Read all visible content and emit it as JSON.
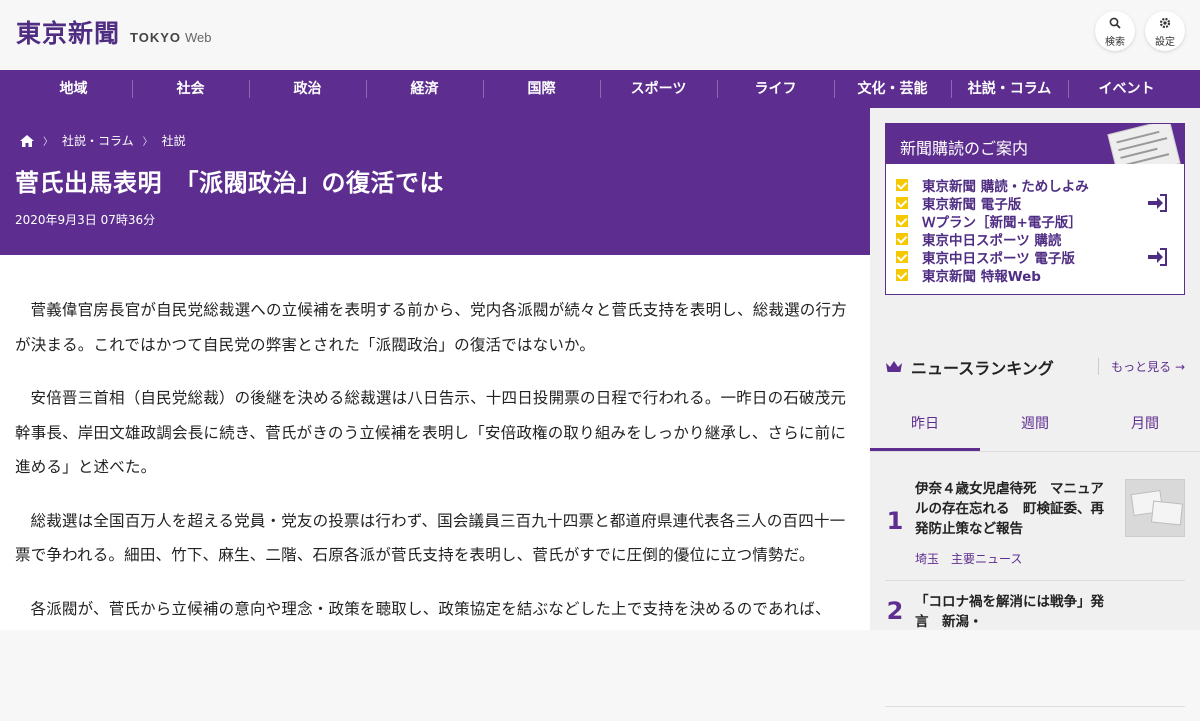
{
  "header": {
    "logo_kanji": "東京新聞",
    "logo_tokyo": "TOKYO",
    "logo_web": "Web",
    "search_label": "検索",
    "settings_label": "設定"
  },
  "nav": {
    "items": [
      "地域",
      "社会",
      "政治",
      "経済",
      "国際",
      "スポーツ",
      "ライフ",
      "文化・芸能",
      "社説・コラム",
      "イベント"
    ]
  },
  "breadcrumb": {
    "items": [
      "社説・コラム",
      "社説"
    ]
  },
  "article": {
    "title": "菅氏出馬表明　「派閥政治」の復活では",
    "date": "2020年9月3日 07時36分",
    "paragraphs": [
      "菅義偉官房長官が自民党総裁選への立候補を表明する前から、党内各派閥が続々と菅氏支持を表明し、総裁選の行方が決まる。これではかつて自民党の弊害とされた「派閥政治」の復活ではないか。",
      "安倍晋三首相（自民党総裁）の後継を決める総裁選は八日告示、十四日投開票の日程で行われる。一昨日の石破茂元幹事長、岸田文雄政調会長に続き、菅氏がきのう立候補を表明し「安倍政権の取り組みをしっかり継承し、さらに前に進める」と述べた。",
      "総裁選は全国百万人を超える党員・党友の投票は行わず、国会議員三百九十四票と都道府県連代表各三人の百四十一票で争われる。細田、竹下、麻生、二階、石原各派が菅氏支持を表明し、菅氏がすでに圧倒的優位に立つ情勢だ。",
      "各派閥が、菅氏から立候補の意向や理念・政策を聴取し、政策協定を結ぶなどした上で支持を決めるのであれば、"
    ]
  },
  "subscription": {
    "heading": "新聞購読のご案内",
    "items": [
      "東京新聞 購読・ためしよみ",
      "東京新聞 電子版",
      "Ｗプラン［新聞+電子版］",
      "東京中日スポーツ 購読",
      "東京中日スポーツ 電子版",
      "東京新聞 特報Web"
    ]
  },
  "ranking": {
    "heading": "ニュースランキング",
    "more": "もっと見る",
    "tabs": [
      "昨日",
      "週間",
      "月間"
    ],
    "items": [
      {
        "rank": "1",
        "title": "伊奈４歳女児虐待死　マニュアルの存在忘れる　町検証委、再発防止策など報告",
        "meta": "埼玉　主要ニュース"
      },
      {
        "rank": "2",
        "title": "「コロナ禍を解消には戦争」発言　新潟・",
        "meta": ""
      }
    ]
  },
  "colors": {
    "brand_purple": "#5d2e8f",
    "check_yellow": "#f5c800"
  }
}
